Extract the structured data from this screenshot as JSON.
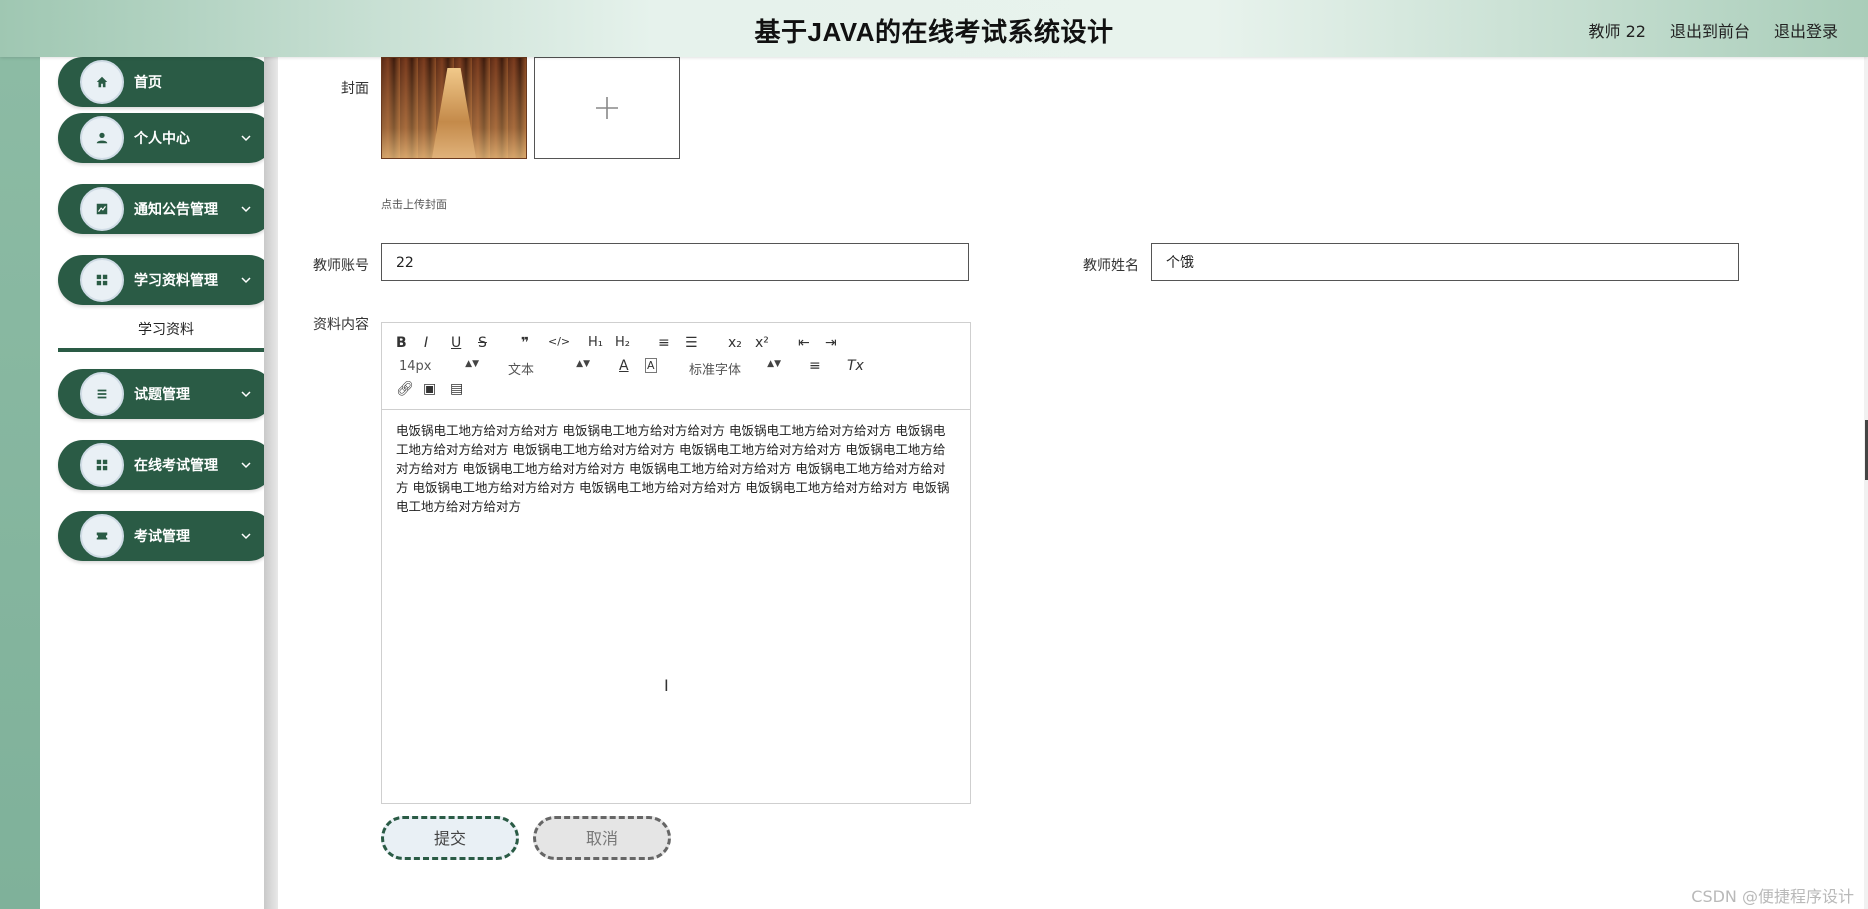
{
  "header": {
    "title": "基于JAVA的在线考试系统设计",
    "user": "教师 22",
    "back_to_front": "退出到前台",
    "logout": "退出登录"
  },
  "sidebar": {
    "items": [
      {
        "label": "首页",
        "icon": "home-icon"
      },
      {
        "label": "个人中心",
        "icon": "user-icon"
      },
      {
        "label": "通知公告管理",
        "icon": "chart-icon"
      },
      {
        "label": "学习资料管理",
        "icon": "grid-icon"
      },
      {
        "label": "试题管理",
        "icon": "list-icon"
      },
      {
        "label": "在线考试管理",
        "icon": "grid-icon"
      },
      {
        "label": "考试管理",
        "icon": "ticket-icon"
      }
    ],
    "active_sub": "学习资料"
  },
  "form": {
    "cover_label": "封面",
    "upload_hint": "点击上传封面",
    "teacher_account_label": "教师账号",
    "teacher_account_value": "22",
    "teacher_name_label": "教师姓名",
    "teacher_name_value": "个饿",
    "content_label": "资料内容",
    "editor": {
      "font_size": "14px",
      "paragraph": "文本",
      "font_family": "标准字体",
      "content": " 电饭锅电工地方给对方给对方 电饭锅电工地方给对方给对方 电饭锅电工地方给对方给对方 电饭锅电工地方给对方给对方 电饭锅电工地方给对方给对方 电饭锅电工地方给对方给对方 电饭锅电工地方给对方给对方 电饭锅电工地方给对方给对方 电饭锅电工地方给对方给对方 电饭锅电工地方给对方给对方 电饭锅电工地方给对方给对方 电饭锅电工地方给对方给对方 电饭锅电工地方给对方给对方 电饭锅电工地方给对方给对方"
    },
    "submit": "提交",
    "cancel": "取消"
  },
  "watermark": "CSDN @便捷程序设计",
  "colors": {
    "brand": "#2a5b45",
    "header_gradient_edge": "#9fc7b2",
    "header_gradient_mid": "#e6f2ec"
  }
}
